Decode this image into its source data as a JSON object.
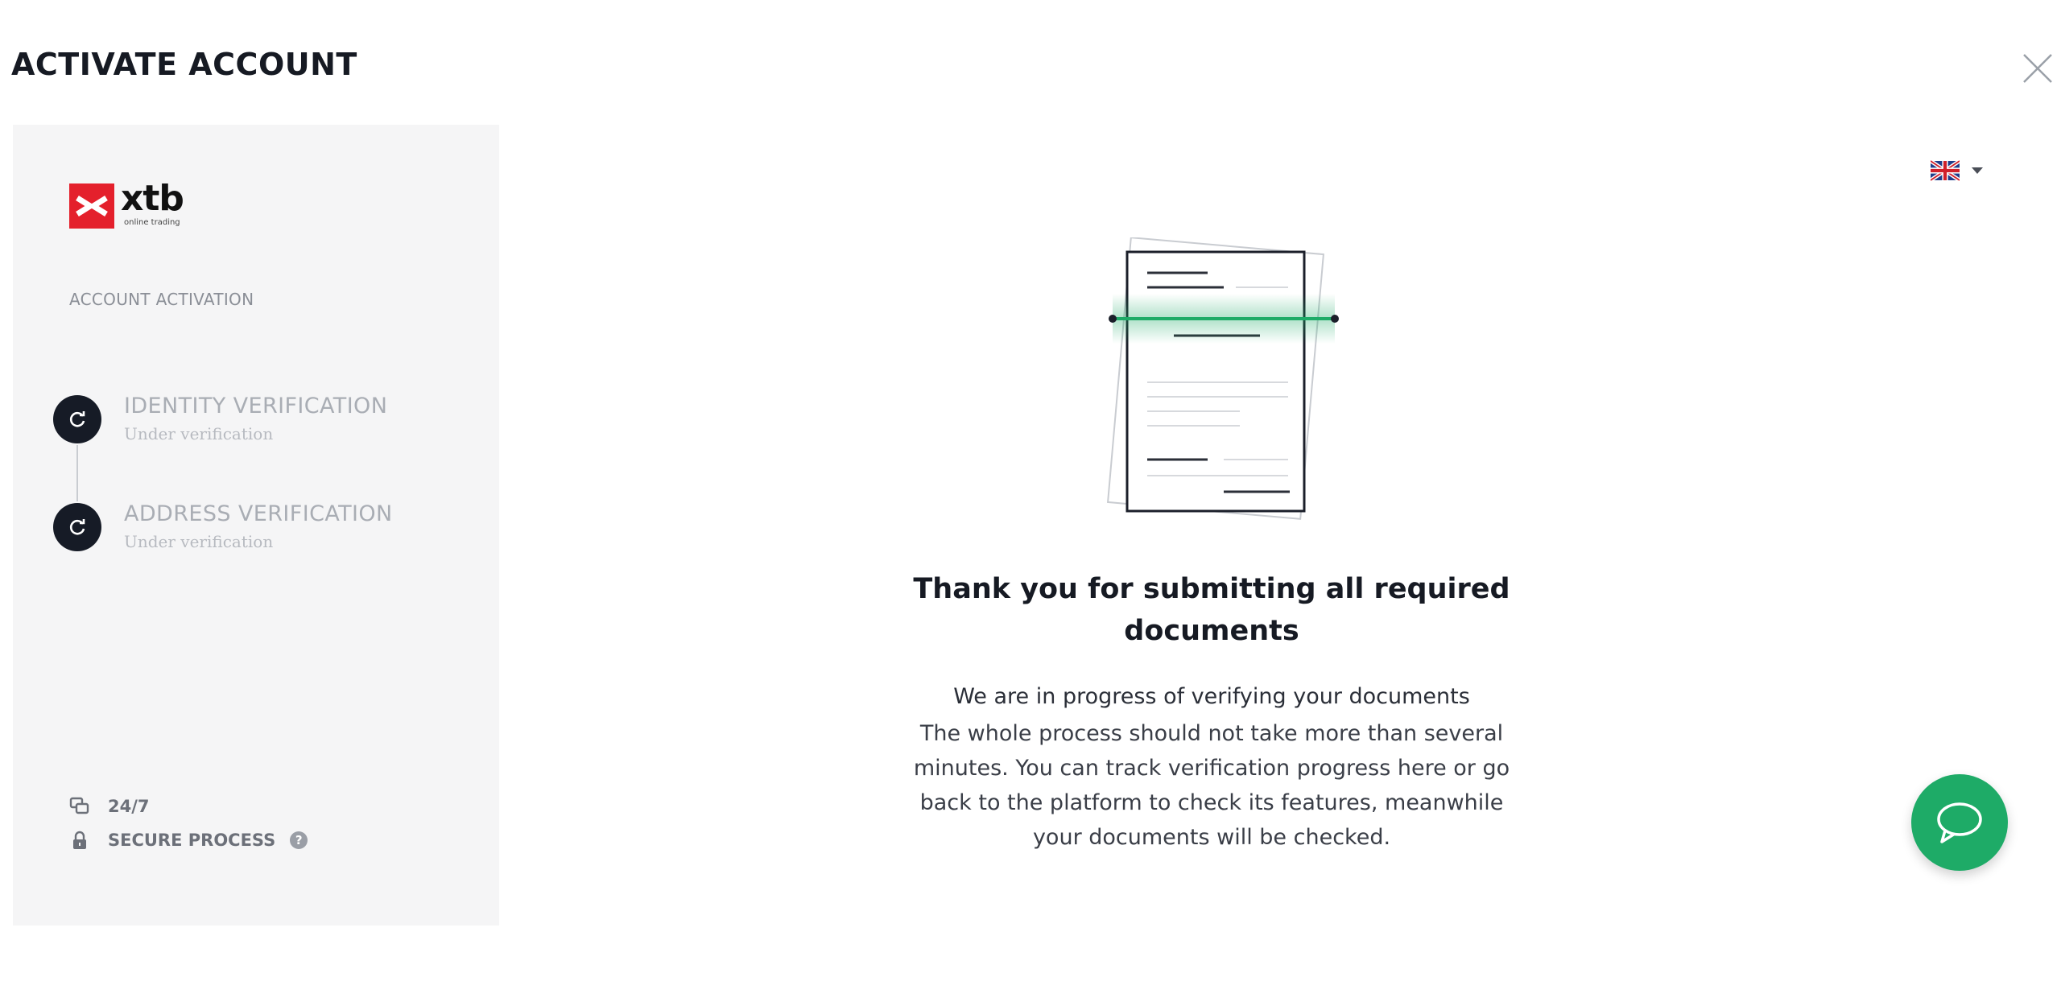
{
  "dialog": {
    "title": "ACTIVATE ACCOUNT"
  },
  "sidebar": {
    "logo": {
      "word": "xtb",
      "tagline": "online trading",
      "brand_color": "#e4202c"
    },
    "section_label": "ACCOUNT ACTIVATION",
    "steps": [
      {
        "title": "IDENTITY VERIFICATION",
        "status": "Under verification",
        "icon": "refresh-icon"
      },
      {
        "title": "ADDRESS VERIFICATION",
        "status": "Under verification",
        "icon": "refresh-icon"
      }
    ],
    "support": {
      "availability": "24/7",
      "security": "SECURE PROCESS"
    }
  },
  "language": {
    "selected": "English",
    "flag_icon": "uk-flag-icon"
  },
  "main": {
    "headline": "Thank you for submitting all required documents",
    "status": "We are in progress of verifying your documents",
    "body": "The whole process should not take more than several minutes. You can track verification progress here or go back to the platform to check its features, meanwhile your documents will be checked."
  },
  "colors": {
    "accent_green": "#1eab67",
    "step_icon_bg": "#161b26",
    "sidebar_bg": "#f5f5f6"
  }
}
